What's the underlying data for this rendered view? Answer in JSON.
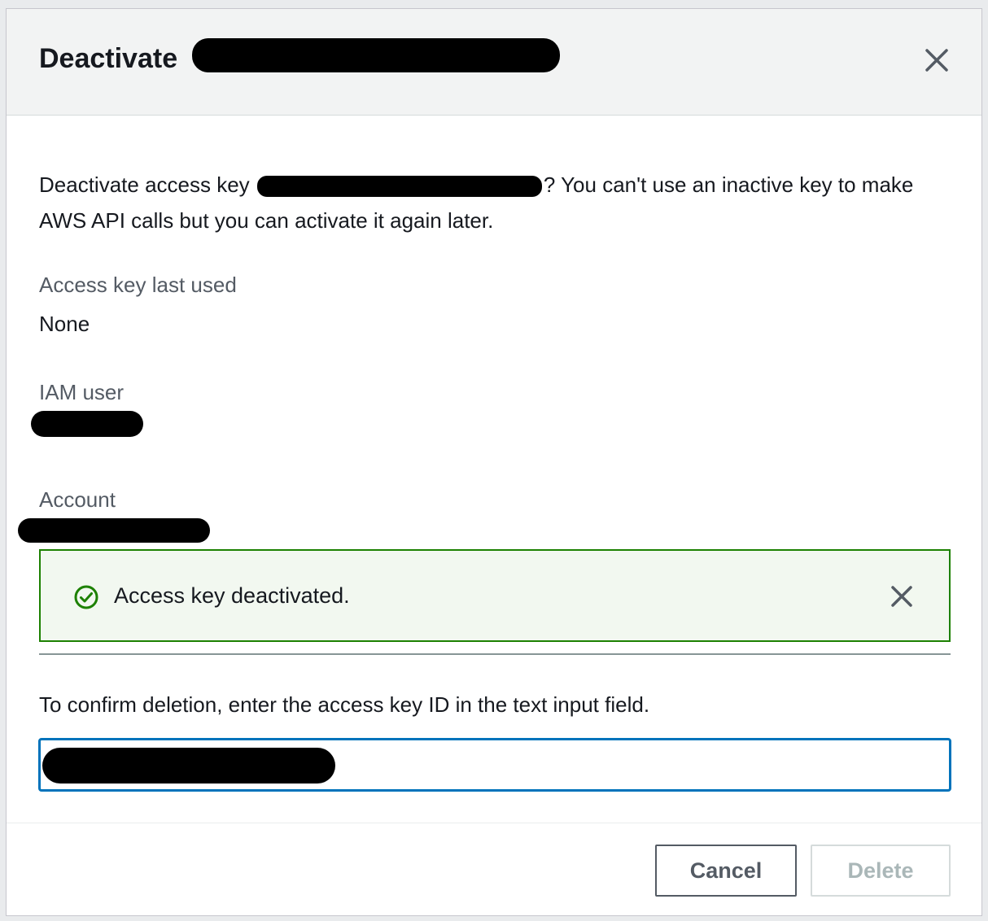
{
  "modal": {
    "title": "Deactivate",
    "description_before": "Deactivate access key ",
    "description_after": "? You can't use an inactive key to make AWS API calls but you can activate it again later.",
    "fields": {
      "last_used_label": "Access key last used",
      "last_used_value": "None",
      "iam_user_label": "IAM user",
      "account_label": "Account"
    },
    "alert": {
      "type": "success",
      "message": "Access key deactivated.",
      "icon": "check-circle-icon",
      "color": "#1d8102"
    },
    "confirm": {
      "prompt": "To confirm deletion, enter the access key ID in the text input field.",
      "input_value": ""
    },
    "footer": {
      "cancel_label": "Cancel",
      "delete_label": "Delete"
    }
  },
  "colors": {
    "focus_border": "#0073bb",
    "success": "#1d8102",
    "disabled_text": "#aab7b8"
  }
}
